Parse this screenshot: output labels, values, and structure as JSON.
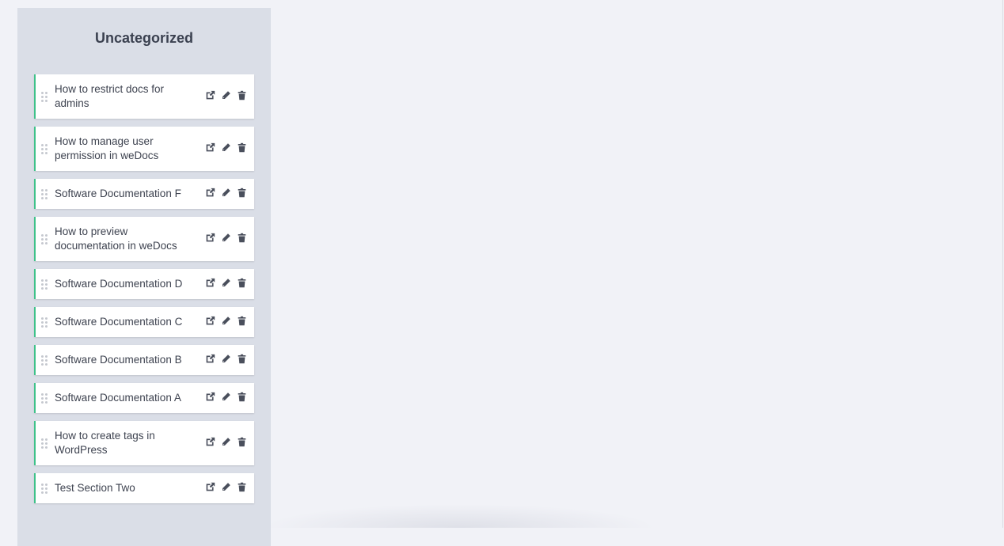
{
  "section": {
    "title": "Uncategorized",
    "items": [
      {
        "title": "How to restrict docs for admins",
        "lines": 2
      },
      {
        "title": "How to manage user permission in weDocs",
        "lines": 2
      },
      {
        "title": "Software Documentation F",
        "lines": 1
      },
      {
        "title": "How to preview documentation in weDocs",
        "lines": 2
      },
      {
        "title": "Software Documentation D",
        "lines": 1
      },
      {
        "title": "Software Documentation C",
        "lines": 1
      },
      {
        "title": "Software Documentation B",
        "lines": 1
      },
      {
        "title": "Software Documentation A",
        "lines": 1
      },
      {
        "title": "How to create tags in WordPress",
        "lines": 2
      },
      {
        "title": "Test Section Two",
        "lines": 1
      }
    ],
    "actions": {
      "view_icon": "external-link-icon",
      "edit_icon": "pencil-icon",
      "delete_icon": "trash-icon"
    }
  },
  "colors": {
    "accent": "#3ec28a",
    "column_bg": "#dadee7",
    "page_bg": "#f1f2f7",
    "text": "#3e4350"
  }
}
